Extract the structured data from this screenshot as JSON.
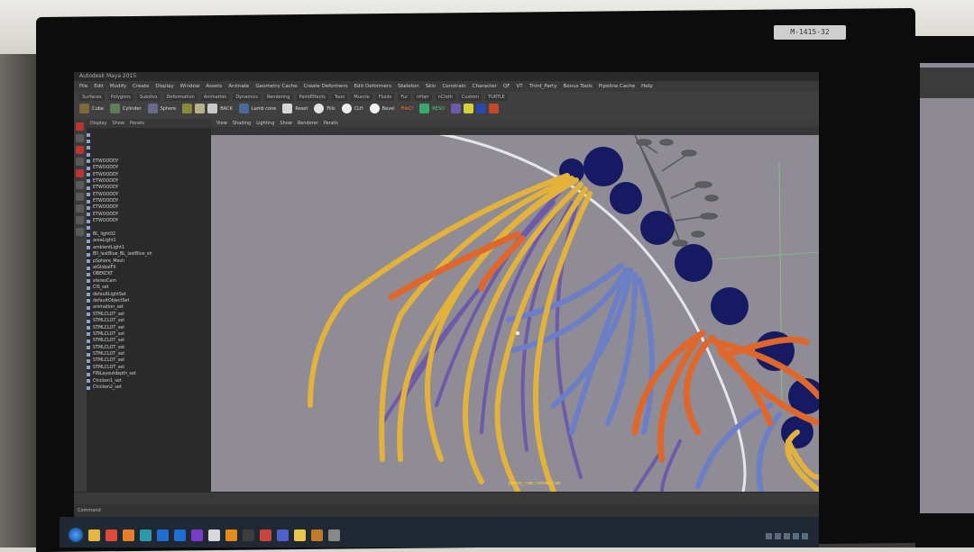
{
  "monitor": {
    "label": "M-1415-32"
  },
  "app": {
    "title": "Autodesk Maya 2015",
    "menu": [
      "File",
      "Edit",
      "Modify",
      "Create",
      "Display",
      "Window",
      "Assets",
      "Animate",
      "Geometry Cache",
      "Create Deformers",
      "Edit Deformers",
      "Skeleton",
      "Skin",
      "Constrain",
      "Character",
      "QF",
      "VT",
      "Third_Party",
      "Bonus Tools",
      "Pipeline Cache",
      "Help"
    ],
    "shelf_tabs": [
      "Surfaces",
      "Polygons",
      "Subdivs",
      "Deformation",
      "Animation",
      "Dynamics",
      "Rendering",
      "PaintEffects",
      "Toon",
      "Muscle",
      "Fluids",
      "Fur",
      "nHair",
      "nCloth",
      "Custom",
      "TURTLE"
    ],
    "shelf_labels": [
      "Cube",
      "Cylinder",
      "Sphere",
      "BACK",
      "Lamb cone",
      "Reset",
      "FileCf",
      "RESO",
      "Fills",
      "Bevel",
      "CLH"
    ],
    "outliner_menu": [
      "Display",
      "Show",
      "Panels"
    ],
    "outliner_items": [
      "",
      "",
      "",
      "",
      "ETWOODDY",
      "ETWOODDY",
      "ETWOODDY",
      "ETWOODDY",
      "ETWOODDY",
      "ETWOODDY",
      "ETWOODDY",
      "ETWOODDY",
      "ETWOODDY",
      "ETWOODDY",
      "",
      "BL_light02",
      "areaLight1",
      "ambientLight1",
      "Bll_lastBlue_BL_lastBlue_sh",
      "pSphere_Mesh",
      "aiGlobalFX",
      "OBEKCKT",
      "stereoCam",
      "CIS_set",
      "defaultLightSet",
      "defaultObjectSet",
      "animation_set",
      "STMLCLOT_set",
      "STMLCLOT_set",
      "STMLCLOT_set",
      "STMLCLOT_set",
      "STMLCLOT_set",
      "STMLCLOT_set",
      "STMLCLOT_set",
      "STMLCLOT_set",
      "STMLCLOT_set",
      "FINLayoutdepth_set",
      "Chicken1_set",
      "Chicken2_set"
    ],
    "viewport_menu": [
      "View",
      "Shading",
      "Lighting",
      "Show",
      "Renderer",
      "Panels"
    ],
    "frame_readout": "persp_cam:renderCam",
    "timeslider_label": "Command"
  },
  "colors": {
    "viewport_bg": "#8f8c96",
    "yellow_strands": "#e2b23a",
    "orange_strands": "#e0672b",
    "blue_strands": "#6b7ec6",
    "purple_strands": "#6d5aa8",
    "dark_spheres": "#151a63"
  },
  "taskbar": {
    "icons": [
      "start",
      "explorer",
      "chrome",
      "firefox",
      "maya",
      "photoshop",
      "photoshop2",
      "premiere",
      "nuke",
      "vlc",
      "terminal",
      "mail",
      "teams",
      "notes",
      "files",
      "settings"
    ]
  }
}
